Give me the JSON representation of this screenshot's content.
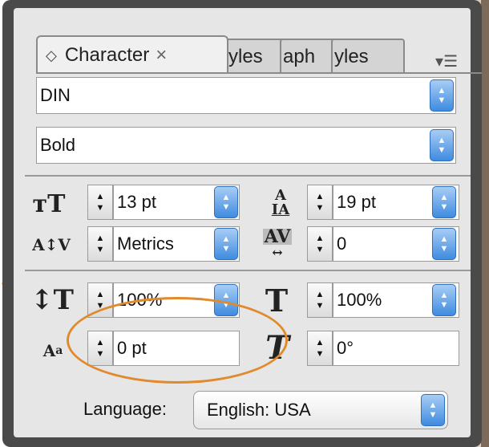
{
  "panel": {
    "tabs": [
      {
        "label": "Character",
        "active": true,
        "prefix_icon": "diamond-icon",
        "close_icon": "close-icon"
      },
      {
        "label": "yles"
      },
      {
        "label": "aph"
      },
      {
        "label": "yles"
      }
    ],
    "collapse_glyph": "▸▸",
    "menu_glyph": "▾☰"
  },
  "font": {
    "family_value": "DIN",
    "style_value": "Bold"
  },
  "controls": {
    "font_size": "13 pt",
    "leading": "19 pt",
    "kerning": "Metrics",
    "tracking": "0",
    "vertical_scale": "100%",
    "horizontal_scale": "100%",
    "baseline_shift": "0 pt",
    "skew": "0°"
  },
  "language": {
    "label": "Language:",
    "value": "English: USA"
  },
  "annotation": {
    "color": "#e08a2c"
  }
}
